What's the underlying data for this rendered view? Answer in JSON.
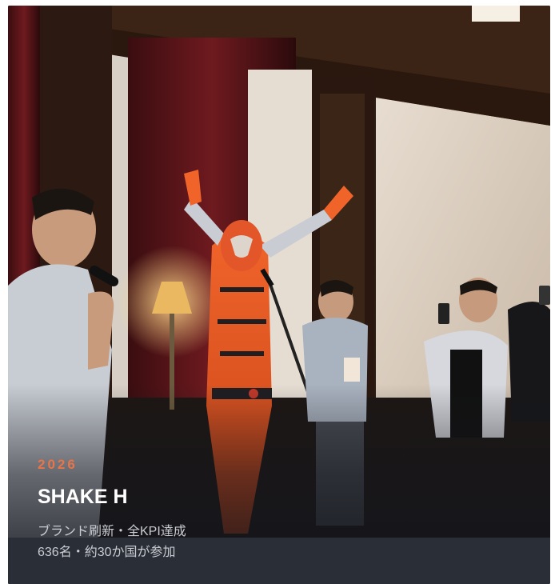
{
  "card": {
    "year": "2026",
    "title": "SHAKE H",
    "description_lines": [
      "ブランド刷新・全KPI達成",
      "636名・約30か国が参加"
    ]
  },
  "colors": {
    "year_accent": "#e8744a",
    "title_text": "#ffffff",
    "description_text": "#c9ccd2",
    "footer_strip": "#2a2e36"
  },
  "photo": {
    "icon": "event-photo"
  }
}
